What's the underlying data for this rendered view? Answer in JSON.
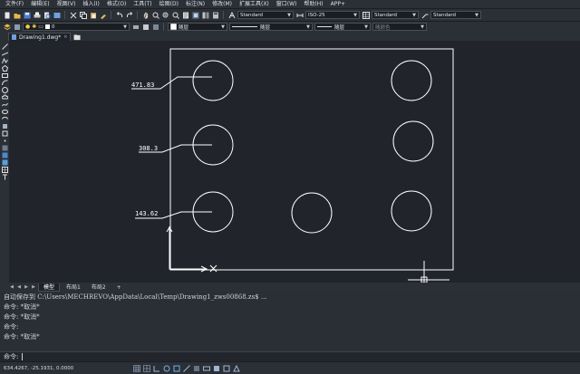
{
  "menubar": {
    "items": [
      "文件(F)",
      "编辑(E)",
      "视图(V)",
      "插入(I)",
      "格式(O)",
      "工具(T)",
      "绘图(D)",
      "标注(N)",
      "修改(M)",
      "扩展工具(X)",
      "窗口(W)",
      "帮助(H)",
      "APP+"
    ]
  },
  "toolbar": {
    "text_style": "Standard",
    "dim_style": "ISO-25",
    "table_style": "Standard",
    "mleader_style": "Standard",
    "layer": "0",
    "color": "随层",
    "linetype": "随层",
    "lineweight": "随层",
    "plotstyle": "随颜色"
  },
  "doc_tabs": [
    {
      "label": "Drawing1.dwg*"
    }
  ],
  "drawing": {
    "dims": [
      "471.83",
      "308.3",
      "143.62"
    ]
  },
  "layout_tabs": [
    "模型",
    "布局1",
    "布局2",
    "+"
  ],
  "command": {
    "history": [
      "自动保存到 C:\\Users\\MECHREVO\\AppData\\Local\\Temp\\Drawing1_zws00868.zs$ ...",
      "命令: *取消*",
      "命令: *取消*",
      "命令:",
      "命令: *取消*"
    ],
    "prompt": "命令:"
  },
  "status": {
    "coords": "634.4267, -25.1931, 0.0000"
  },
  "colors": {
    "background": "#21252b",
    "drawing": "#ffffff",
    "ui": "#2b2f36"
  }
}
